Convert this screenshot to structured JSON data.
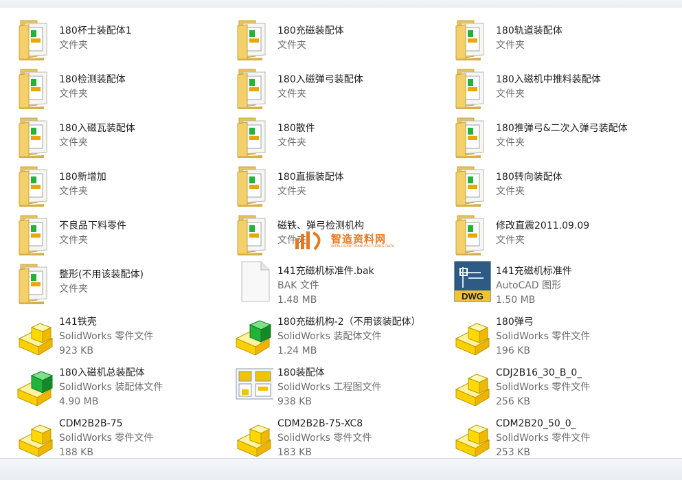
{
  "items": [
    {
      "name": "180杯士装配体1",
      "type": "文件夹",
      "size": "",
      "icon": "folder-icon"
    },
    {
      "name": "180充磁装配体",
      "type": "文件夹",
      "size": "",
      "icon": "folder-icon"
    },
    {
      "name": "180轨道装配体",
      "type": "文件夹",
      "size": "",
      "icon": "folder-icon"
    },
    {
      "name": "180检测装配体",
      "type": "文件夹",
      "size": "",
      "icon": "folder-icon"
    },
    {
      "name": "180入磁弹弓装配体",
      "type": "文件夹",
      "size": "",
      "icon": "folder-icon"
    },
    {
      "name": "180入磁机中推料装配体",
      "type": "文件夹",
      "size": "",
      "icon": "folder-icon"
    },
    {
      "name": "180入磁瓦装配体",
      "type": "文件夹",
      "size": "",
      "icon": "folder-icon"
    },
    {
      "name": "180散件",
      "type": "文件夹",
      "size": "",
      "icon": "folder-icon"
    },
    {
      "name": "180推弹弓&二次入弹弓装配体",
      "type": "文件夹",
      "size": "",
      "icon": "folder-icon"
    },
    {
      "name": "180新增加",
      "type": "文件夹",
      "size": "",
      "icon": "folder-icon"
    },
    {
      "name": "180直振装配体",
      "type": "文件夹",
      "size": "",
      "icon": "folder-icon"
    },
    {
      "name": "180转向装配体",
      "type": "文件夹",
      "size": "",
      "icon": "folder-icon"
    },
    {
      "name": "不良品下料零件",
      "type": "文件夹",
      "size": "",
      "icon": "folder-icon"
    },
    {
      "name": "磁铁、弹弓检测机构",
      "type": "文件夹",
      "size": "",
      "icon": "folder-icon"
    },
    {
      "name": "修改直震2011.09.09",
      "type": "文件夹",
      "size": "",
      "icon": "folder-icon"
    },
    {
      "name": "整形(不用该装配体)",
      "type": "文件夹",
      "size": "",
      "icon": "folder-icon"
    },
    {
      "name": "141充磁机标准件.bak",
      "type": "BAK 文件",
      "size": "1.48 MB",
      "icon": "blank-file-icon"
    },
    {
      "name": "141充磁机标准件",
      "type": "AutoCAD 图形",
      "size": "1.50 MB",
      "icon": "dwg-file-icon"
    },
    {
      "name": "141铁壳",
      "type": "SolidWorks 零件文件",
      "size": "923 KB",
      "icon": "solidworks-part-icon"
    },
    {
      "name": "180充磁机构-2（不用该装配体）",
      "type": "SolidWorks 装配体文件",
      "size": "1.24 MB",
      "icon": "solidworks-assembly-icon"
    },
    {
      "name": "180弹弓",
      "type": "SolidWorks 零件文件",
      "size": "196 KB",
      "icon": "solidworks-part-icon"
    },
    {
      "name": "180入磁机总装配体",
      "type": "SolidWorks 装配体文件",
      "size": "4.90 MB",
      "icon": "solidworks-assembly-icon"
    },
    {
      "name": "180装配体",
      "type": "SolidWorks 工程图文件",
      "size": "938 KB",
      "icon": "solidworks-drawing-icon"
    },
    {
      "name": "CDJ2B16_30_B_0_",
      "type": "SolidWorks 零件文件",
      "size": "256 KB",
      "icon": "solidworks-part-icon"
    },
    {
      "name": "CDM2B2B-75",
      "type": "SolidWorks 零件文件",
      "size": "188 KB",
      "icon": "solidworks-part-icon"
    },
    {
      "name": "CDM2B2B-75-XC8",
      "type": "SolidWorks 零件文件",
      "size": "183 KB",
      "icon": "solidworks-part-icon"
    },
    {
      "name": "CDM2B20_50_0_",
      "type": "SolidWorks 零件文件",
      "size": "253 KB",
      "icon": "solidworks-part-icon"
    }
  ],
  "watermark": {
    "title": "智造资料网",
    "subtitle": "INTELLIGENT MANUFACTURING DATA"
  },
  "colors": {
    "folder": "#f2d57a",
    "part": "#ffe600",
    "assembly_green": "#1fb33a",
    "watermark": "#e87722"
  }
}
